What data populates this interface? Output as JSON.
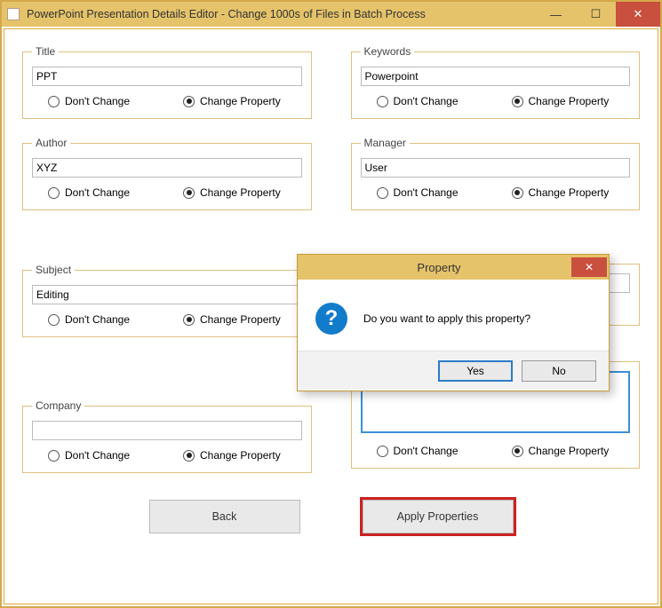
{
  "window": {
    "title": "PowerPoint Presentation Details Editor - Change 1000s of Files in Batch Process"
  },
  "labels": {
    "dont_change": "Don't Change",
    "change_property": "Change Property"
  },
  "groups": {
    "title": {
      "legend": "Title",
      "value": "PPT",
      "sel": "change"
    },
    "keywords": {
      "legend": "Keywords",
      "value": "Powerpoint",
      "sel": "change"
    },
    "author": {
      "legend": "Author",
      "value": "XYZ",
      "sel": "change"
    },
    "manager": {
      "legend": "Manager",
      "value": "User",
      "sel": "change"
    },
    "subject": {
      "legend": "Subject",
      "value": "Editing",
      "sel": "change"
    },
    "category": {
      "legend": " ",
      "value": "",
      "sel": "change"
    },
    "company": {
      "legend": "Company",
      "value": "",
      "sel": "change"
    },
    "comments": {
      "legend": " ",
      "value": "",
      "sel": "change"
    }
  },
  "buttons": {
    "back": "Back",
    "apply": "Apply Properties"
  },
  "dialog": {
    "title": "Property",
    "message": "Do you want to apply this property?",
    "yes": "Yes",
    "no": "No"
  }
}
